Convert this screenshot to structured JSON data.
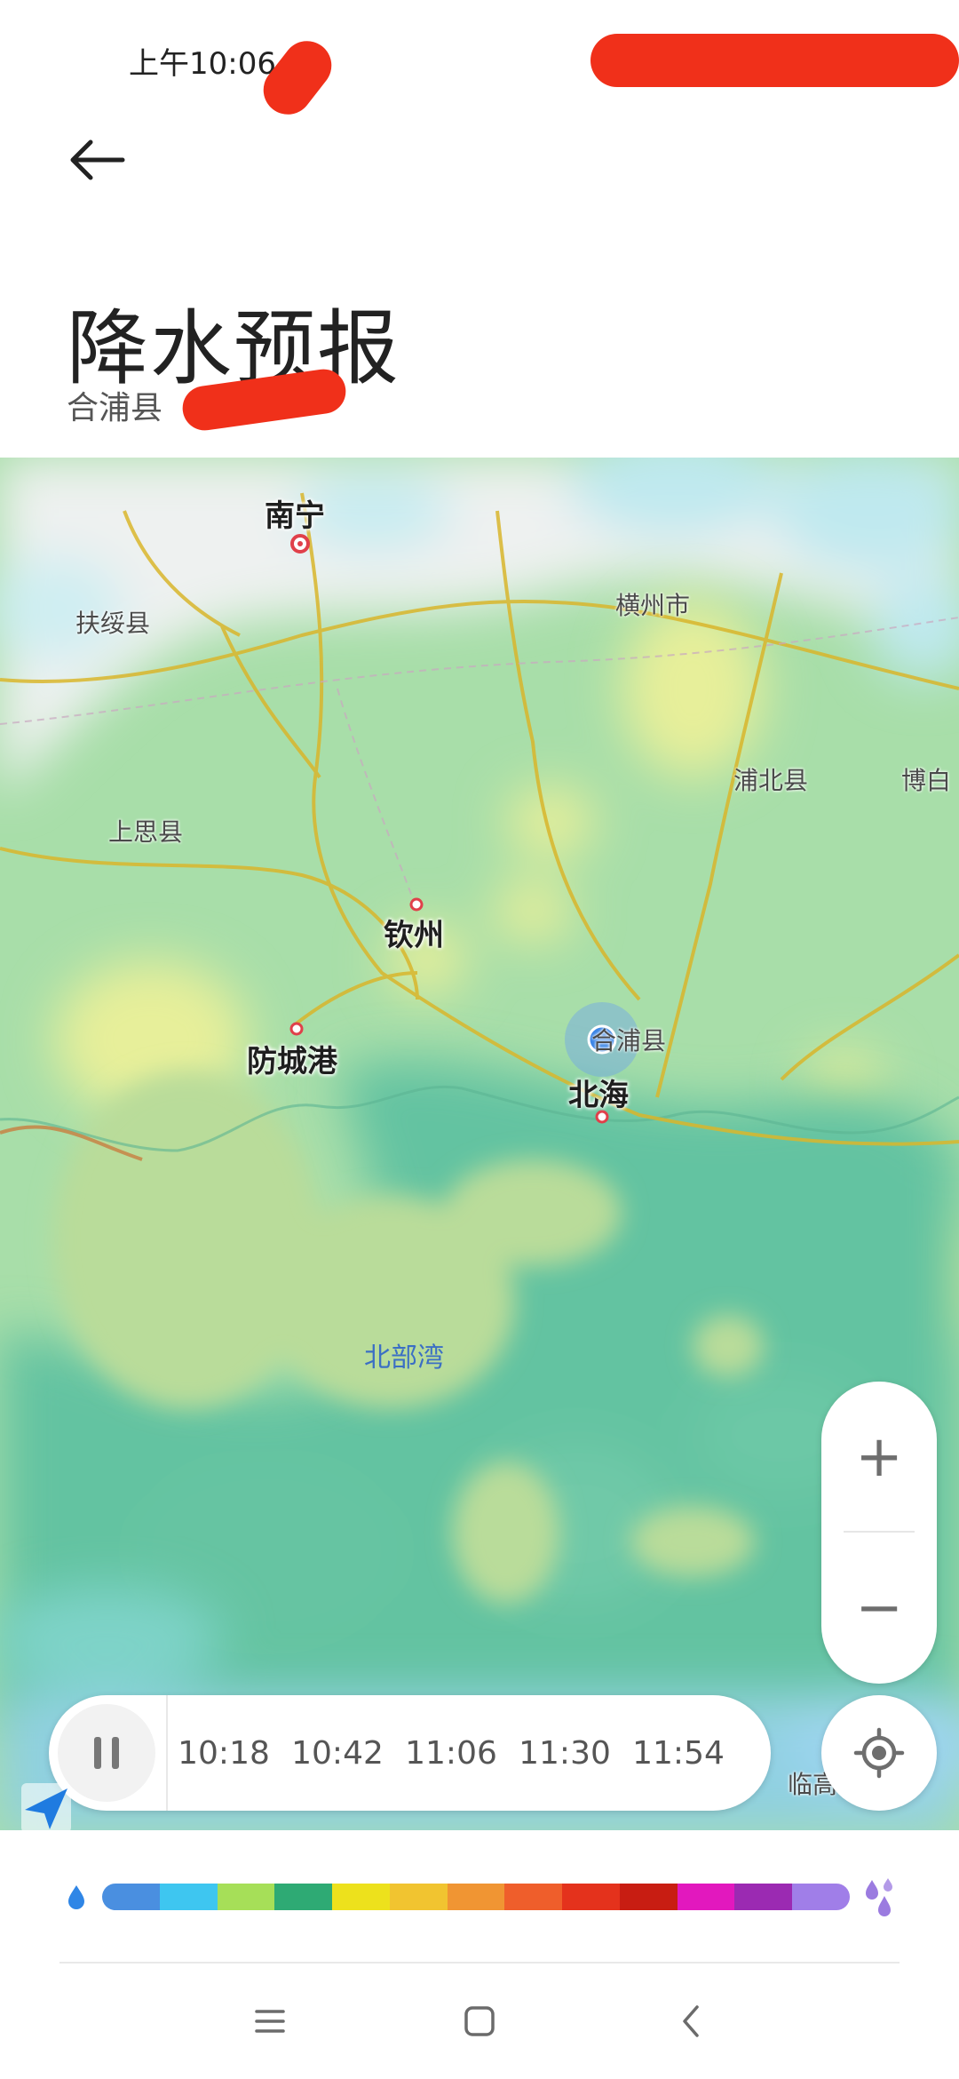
{
  "status_bar": {
    "time": "上午10:06"
  },
  "header": {
    "title": "降水预报",
    "location": "合浦县"
  },
  "map": {
    "cities": [
      "南宁",
      "钦州",
      "防城港",
      "北海"
    ],
    "towns": [
      "扶绥县",
      "横州市",
      "浦北县",
      "博白",
      "上思县",
      "合浦县",
      "临高"
    ],
    "sea_label": "北部湾"
  },
  "zoom": {
    "plus": "+",
    "minus": "−"
  },
  "timeline": {
    "times": [
      "10:18",
      "10:42",
      "11:06",
      "11:30",
      "11:54"
    ]
  },
  "legend": {
    "colors": [
      "#4a8fe0",
      "#3ec6f0",
      "#a6df58",
      "#2eaa74",
      "#ede11c",
      "#f1c430",
      "#f09533",
      "#ef5e2b",
      "#e4321c",
      "#c81d12",
      "#e218be",
      "#9b2ab2",
      "#a07ee8"
    ]
  },
  "icons": [
    "back-arrow-icon",
    "pause-icon",
    "locate-icon",
    "send-arrow-icon",
    "raindrop-small-icon",
    "raindrop-heavy-icon",
    "menu-icon",
    "home-square-icon",
    "back-chevron-icon"
  ]
}
